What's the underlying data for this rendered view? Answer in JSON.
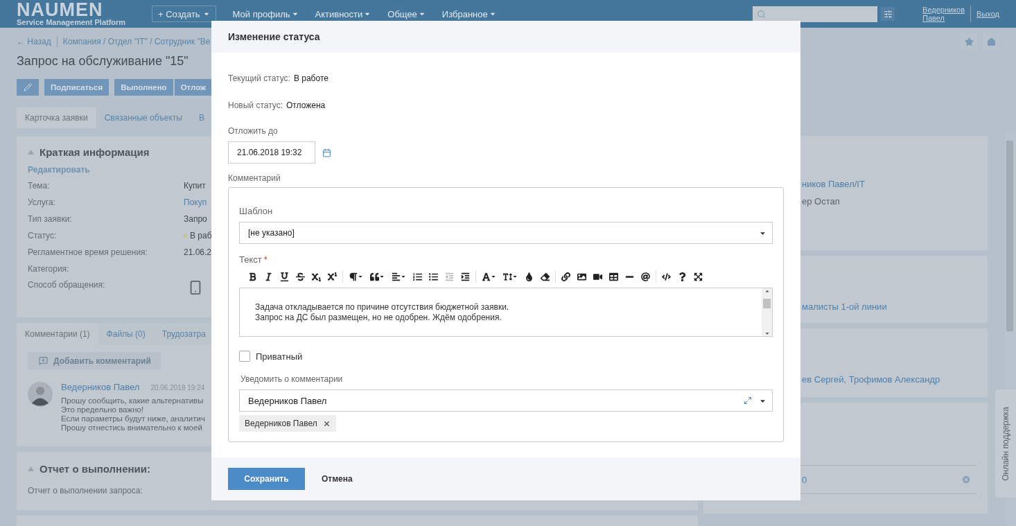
{
  "header": {
    "logo": "NAUMEN",
    "logo_subtitle": "Service Management Platform",
    "create_button": "+ Создать",
    "menu": [
      "Мой профиль",
      "Активности",
      "Общее",
      "Избранное"
    ],
    "user": [
      "Ведерников",
      "Павел"
    ],
    "logout": "Выход"
  },
  "breadcrumb": {
    "back": "← Назад",
    "path": "Компания / Отдел \"IT\" / Сотрудник \"Ве"
  },
  "title": "Запрос на обслуживание \"15\"",
  "actions": [
    "Подписаться",
    "Выполнено",
    "Отлож"
  ],
  "tabs": [
    {
      "label": "Карточка заявки",
      "selected": true
    },
    {
      "label": "Связанные объекты",
      "selected": false
    },
    {
      "label": "В",
      "selected": false
    }
  ],
  "summary": {
    "title": "Краткая информация",
    "expanded": true,
    "edit_link": "Редактировать",
    "fields": [
      {
        "label": "Тема:",
        "kind": "text",
        "value": "Купит"
      },
      {
        "label": "Услуга:",
        "kind": "link",
        "value": "Покуп"
      },
      {
        "label": "Тип заявки:",
        "kind": "text",
        "value": "Запро"
      },
      {
        "label": "Статус:",
        "kind": "status",
        "value": "В раб"
      },
      {
        "label": "Регламентное время решения:",
        "kind": "text",
        "value": "21.06.2"
      },
      {
        "label": "Категория:",
        "kind": "empty"
      },
      {
        "label": "Способ обращения:",
        "kind": "phone"
      }
    ]
  },
  "comment_tabs": [
    {
      "label": "Комментарии (1)",
      "selected": true
    },
    {
      "label": "Файлы (0)",
      "selected": false
    },
    {
      "label": "Трудозатра",
      "selected": false
    }
  ],
  "add_comment": "Добавить комментарий",
  "comments": [
    {
      "author": "Ведерников Павел",
      "date": "20.06.2018 19:24",
      "lines": [
        "Прошу сообщить, какие альтернативы",
        "Это предельно важно!",
        "Если параметры будут ниже, аналитич",
        "Прошу отнестись внимательно к моей"
      ]
    }
  ],
  "report": {
    "title": "Отчет о выполнении:",
    "expanded": true,
    "field": "Отчет о выполнении запроса:"
  },
  "right_cards": [
    {
      "kind": "lines",
      "lines": [
        {
          "kind": "link",
          "text": "ников Павел/IT"
        },
        {
          "kind": "text",
          "text": "ер Остап"
        }
      ]
    },
    {
      "kind": "lines",
      "lines": [
        {
          "kind": "link",
          "text": "малисты 1-ой линии"
        }
      ]
    },
    {
      "kind": "lines",
      "lines": [
        {
          "kind": "link",
          "text": "ев Сергей, Трофимов Александр"
        }
      ]
    },
    {
      "kind": "input",
      "value": "0"
    }
  ],
  "support_tab": "Онлайн поддержка",
  "dialog": {
    "title": "Изменение статуса",
    "current_status": {
      "label": "Текущий статус:",
      "value": "В работе"
    },
    "new_status": {
      "label": "Новый статус:",
      "value": "Отложена"
    },
    "postpone": {
      "label": "Отложить до",
      "value": "21.06.2018 19:32"
    },
    "comment_label": "Комментарий",
    "template": {
      "label": "Шаблон",
      "value": "[не указано]"
    },
    "text": {
      "label": "Текст",
      "required_mark": "*",
      "toolbar": [
        {
          "kind": "bold",
          "disabled": false
        },
        {
          "kind": "italic",
          "disabled": false
        },
        {
          "kind": "underline",
          "disabled": false
        },
        {
          "kind": "strike",
          "disabled": false
        },
        {
          "kind": "subscript",
          "disabled": false
        },
        {
          "kind": "superscript",
          "disabled": false
        },
        {
          "kind": "separator"
        },
        {
          "kind": "paragraph",
          "disabled": false
        },
        {
          "kind": "quote",
          "disabled": false
        },
        {
          "kind": "align",
          "disabled": false
        },
        {
          "kind": "ordered-list",
          "disabled": false
        },
        {
          "kind": "bullet-list",
          "disabled": false
        },
        {
          "kind": "outdent",
          "disabled": true
        },
        {
          "kind": "indent",
          "disabled": false
        },
        {
          "kind": "separator"
        },
        {
          "kind": "font",
          "disabled": false
        },
        {
          "kind": "font-size",
          "disabled": false
        },
        {
          "kind": "color",
          "disabled": false
        },
        {
          "kind": "eraser",
          "disabled": false
        },
        {
          "kind": "separator"
        },
        {
          "kind": "link",
          "disabled": false
        },
        {
          "kind": "image",
          "disabled": false
        },
        {
          "kind": "video",
          "disabled": false
        },
        {
          "kind": "table",
          "disabled": false
        },
        {
          "kind": "rule",
          "disabled": false
        },
        {
          "kind": "mention",
          "disabled": false
        },
        {
          "kind": "separator"
        },
        {
          "kind": "code",
          "disabled": false
        },
        {
          "kind": "help",
          "disabled": false
        },
        {
          "kind": "fullscreen",
          "disabled": false
        }
      ],
      "value": "Задача откладывается по причине отсутствия бюджетной заявки.\nЗапрос на ДС был размещен, но не одобрен. Ждём одобрения."
    },
    "private": {
      "label": "Приватный",
      "checked": false
    },
    "notify": {
      "label": "Уведомить о комментарии",
      "value": "Ведерников Павел",
      "tags": [
        "Ведерников Павел"
      ]
    },
    "save": "Сохранить",
    "cancel": "Отмена"
  }
}
